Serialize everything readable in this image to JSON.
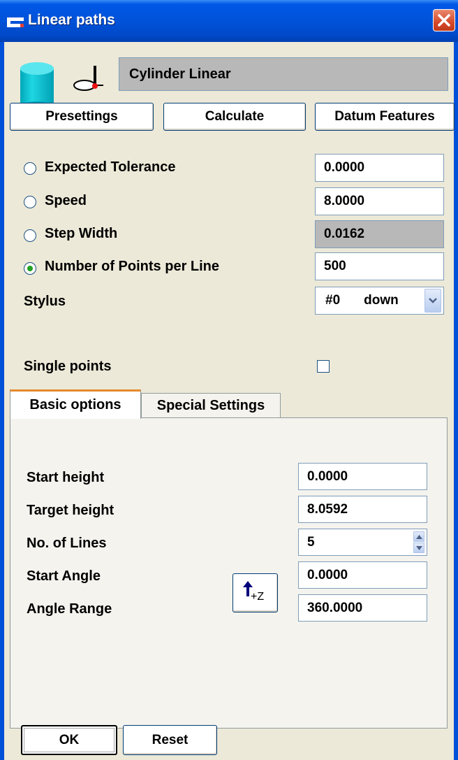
{
  "window": {
    "title": "Linear paths"
  },
  "path_name": "Cylinder Linear",
  "toolbar": {
    "presettings": "Presettings",
    "calculate": "Calculate",
    "datum_features": "Datum Features"
  },
  "options": [
    {
      "label": "Expected Tolerance",
      "value": "0.0000",
      "selected": false,
      "editable": true
    },
    {
      "label": "Speed",
      "value": "8.0000",
      "selected": false,
      "editable": true
    },
    {
      "label": "Step Width",
      "value": "0.0162",
      "selected": false,
      "editable": false
    },
    {
      "label": "Number of Points per Line",
      "value": "500",
      "selected": true,
      "editable": true
    }
  ],
  "stylus": {
    "label": "Stylus",
    "number": "#0",
    "direction": "down"
  },
  "single_points": {
    "label": "Single points",
    "checked": false
  },
  "tabs": [
    {
      "label": "Basic options",
      "active": true
    },
    {
      "label": "Special Settings",
      "active": false
    }
  ],
  "basic": {
    "start_height": {
      "label": "Start height",
      "value": "0.0000"
    },
    "target_height": {
      "label": "Target height",
      "value": "8.0592"
    },
    "lines": {
      "label": "No. of Lines",
      "value": "5"
    },
    "start_angle": {
      "label": "Start Angle",
      "value": "0.0000"
    },
    "angle_range": {
      "label": "Angle Range",
      "value": "360.0000"
    },
    "direction_button": {
      "icon": "arrow-up-icon",
      "text": "+Z"
    }
  },
  "footer": {
    "ok": "OK",
    "reset": "Reset"
  },
  "colors": {
    "title_bar": "#0052d9",
    "window_bg": "#ece9d8",
    "tab_accent": "#e68b2c",
    "radio_selected": "#21a121"
  }
}
